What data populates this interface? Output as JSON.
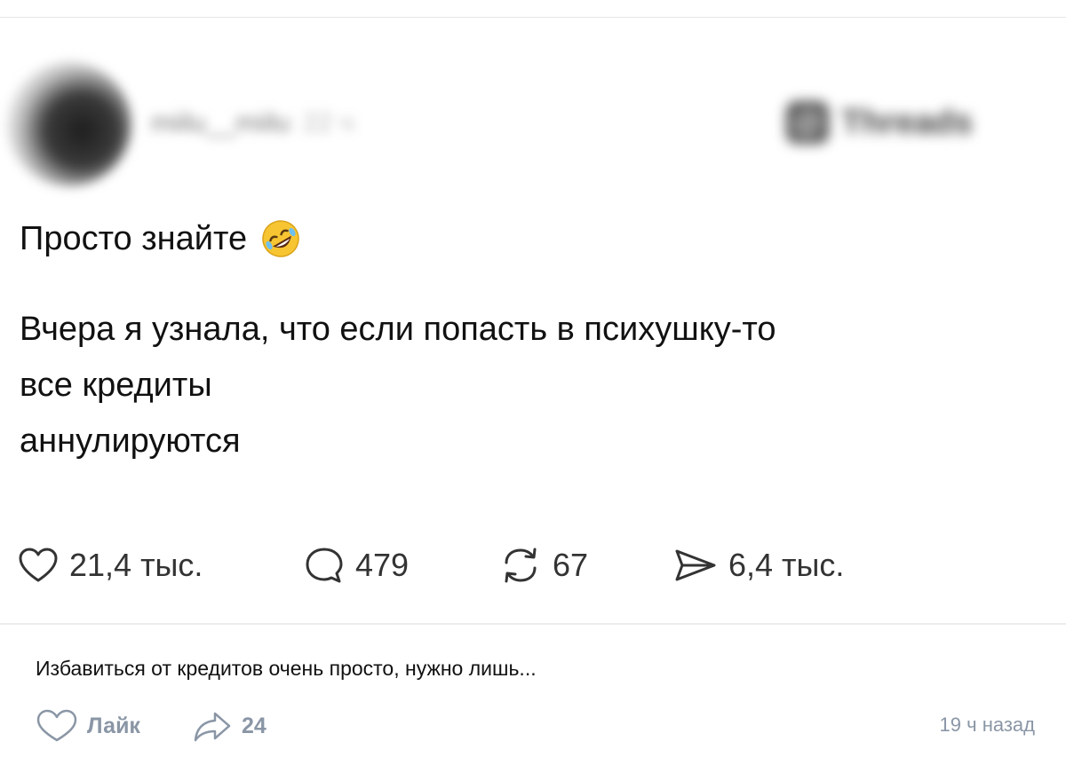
{
  "post": {
    "author": {
      "username": "miilu__miilu",
      "time": "22 ч"
    },
    "platform_badge": {
      "icon": "threads-logo-icon",
      "label": "Threads"
    },
    "title": "Просто знайте",
    "title_emoji": "rolling-on-floor-laughing-icon",
    "body_lines": [
      "Вчера я узнала, что если попасть в психушку-то",
      "все кредиты",
      "аннулируются"
    ],
    "stats": {
      "likes": "21,4 тыс.",
      "comments": "479",
      "reposts": "67",
      "shares": "6,4 тыс."
    }
  },
  "caption": "Избавиться от кредитов очень просто, нужно лишь...",
  "footer": {
    "like_label": "Лайк",
    "share_count": "24",
    "timestamp": "19 ч назад"
  },
  "colors": {
    "text": "#111111",
    "stats_text": "#333333",
    "footer_text": "#8a96a6",
    "divider": "#ececec"
  }
}
